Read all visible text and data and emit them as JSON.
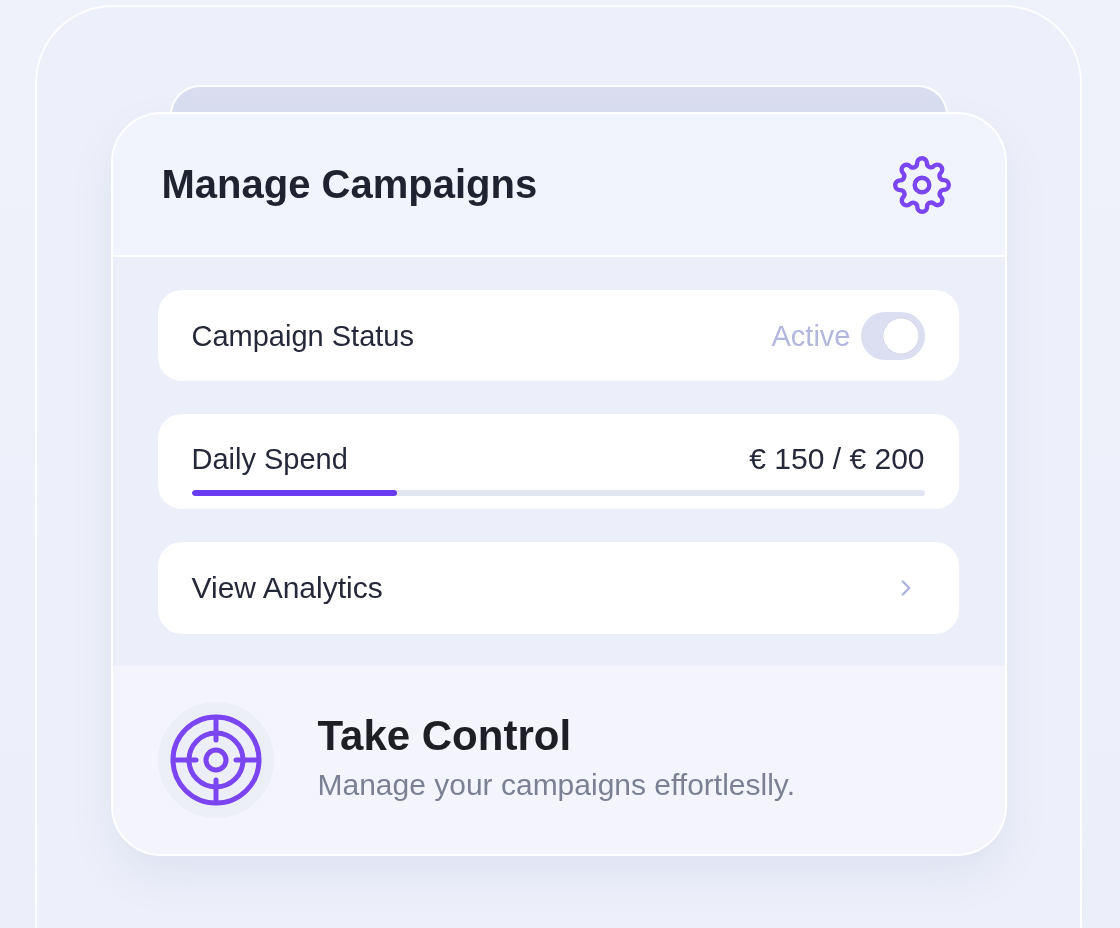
{
  "header": {
    "title": "Manage Campaigns"
  },
  "rows": [
    {
      "kind": "toggle",
      "label": "Campaign Status",
      "status": "Active",
      "on": true
    },
    {
      "kind": "progress",
      "label": "Daily Spend",
      "reading": "€ 150 / € 200",
      "level": 0.28
    },
    {
      "kind": "link",
      "label": "View Analytics"
    }
  ],
  "footer": {
    "title": "Take Control",
    "subtitle": "Manage your campaigns effortleslly."
  }
}
